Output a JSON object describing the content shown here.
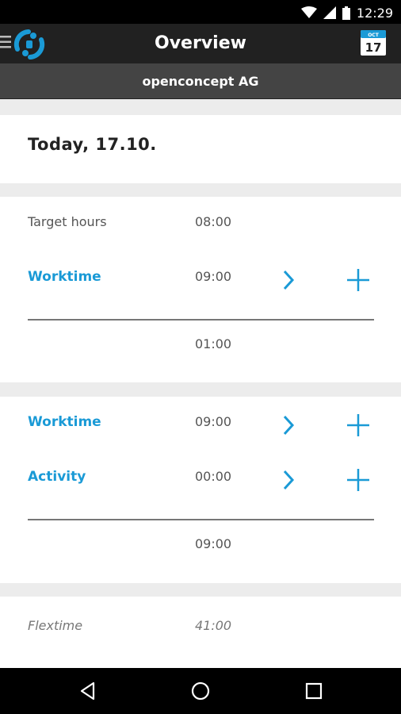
{
  "status_bar": {
    "time": "12:29",
    "icons": [
      "wifi-icon",
      "cell-signal-icon",
      "battery-icon"
    ]
  },
  "app_bar": {
    "title": "Overview",
    "calendar": {
      "month": "OCT",
      "day": "17"
    }
  },
  "company": {
    "name": "openconcept AG"
  },
  "today": {
    "label": "Today, 17.10."
  },
  "summary": {
    "target_label": "Target hours",
    "target_value": "08:00",
    "worktime_label": "Worktime",
    "worktime_value": "09:00",
    "difference": "01:00"
  },
  "entries": {
    "worktime_label": "Worktime",
    "worktime_value": "09:00",
    "activity_label": "Activity",
    "activity_value": "00:00",
    "total": "09:00"
  },
  "flextime": {
    "label": "Flextime",
    "value": "41:00"
  },
  "colors": {
    "accent": "#1a9ad6",
    "app_bar": "#212121",
    "company_bar": "#444444",
    "background": "#ececec"
  }
}
